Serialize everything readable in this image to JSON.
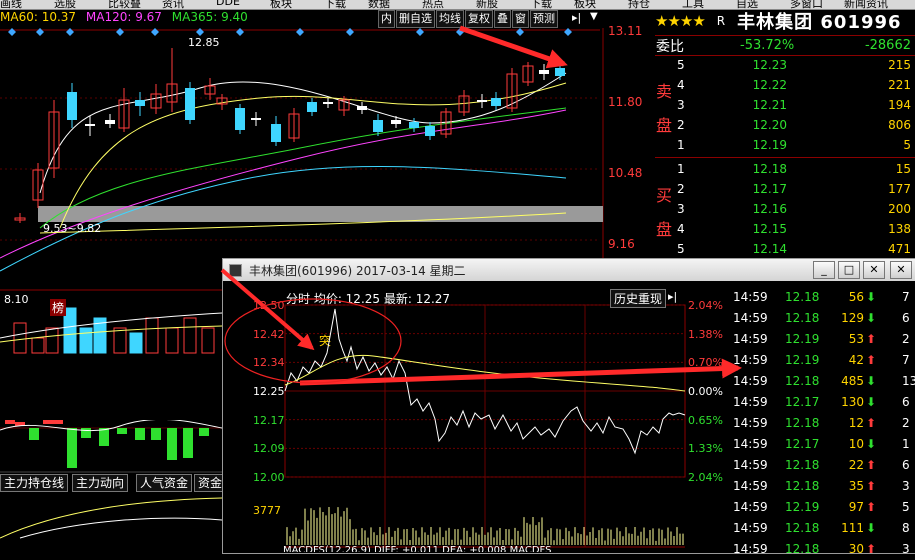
{
  "menu": {
    "items": [
      "画线",
      "选股",
      "比较叠",
      "资讯",
      "DDE",
      "板块",
      "下载",
      "数据",
      "热点",
      "新股",
      "下载",
      "板块",
      "持仓",
      "工具",
      "自选",
      "多窗口",
      "新闻资讯"
    ]
  },
  "ma_bar": {
    "ma60": "MA60: 10.37",
    "ma120": "MA120: 9.67",
    "ma365": "MA365: 9.40"
  },
  "toolbar": {
    "buttons": [
      "内",
      "删自选",
      "均线",
      "复权",
      "叠",
      "窗",
      "预测"
    ]
  },
  "kline": {
    "price_labels": [
      "13.11",
      "11.80",
      "10.48",
      "9.16"
    ],
    "high_label": "12.85",
    "low_label": "9.53~9.82",
    "low2_label": "8.10",
    "bang_label": "榜"
  },
  "sub_tabs": [
    "主力持仓线",
    "主力动向",
    "人气资金",
    "资金"
  ],
  "stock": {
    "stars": "★★★★",
    "r": "R",
    "name": "丰林集团 601996"
  },
  "weibi": {
    "label": "委比",
    "pct": "-53.72%",
    "diff": "-28662"
  },
  "sell_label": [
    "卖",
    "盘"
  ],
  "buy_label": [
    "买",
    "盘"
  ],
  "asks": [
    {
      "level": "5",
      "price": "12.23",
      "volume": "215"
    },
    {
      "level": "4",
      "price": "12.22",
      "volume": "221"
    },
    {
      "level": "3",
      "price": "12.21",
      "volume": "194"
    },
    {
      "level": "2",
      "price": "12.20",
      "volume": "806"
    },
    {
      "level": "1",
      "price": "12.19",
      "volume": "5"
    }
  ],
  "bids": [
    {
      "level": "1",
      "price": "12.18",
      "volume": "15"
    },
    {
      "level": "2",
      "price": "12.17",
      "volume": "177"
    },
    {
      "level": "3",
      "price": "12.16",
      "volume": "200"
    },
    {
      "level": "4",
      "price": "12.15",
      "volume": "138"
    },
    {
      "level": "5",
      "price": "12.14",
      "volume": "471"
    }
  ],
  "popup": {
    "title": "丰林集团(601996) 2017-03-14 星期二",
    "header": "分时 均价: 12.25 最新: 12.27",
    "history_button": "历史重现",
    "left_prices": [
      "12.50",
      "12.42",
      "12.34",
      "12.25",
      "12.17",
      "12.09",
      "12.00"
    ],
    "right_pcts": [
      "2.04%",
      "1.38%",
      "0.70%",
      "0.00%",
      "0.65%",
      "1.33%",
      "2.04%"
    ],
    "volume_label": "3777",
    "tu_label": "突",
    "macd_line": "MACDFS(12,26,9) DIFF: +0.011 DEA: +0.008 MACDFS"
  },
  "ticks": [
    {
      "time": "14:59",
      "price": "12.18",
      "vol": "56",
      "dir": "down",
      "n": "7"
    },
    {
      "time": "14:59",
      "price": "12.18",
      "vol": "129",
      "dir": "down",
      "n": "6"
    },
    {
      "time": "14:59",
      "price": "12.19",
      "vol": "53",
      "dir": "up",
      "n": "2"
    },
    {
      "time": "14:59",
      "price": "12.19",
      "vol": "42",
      "dir": "up",
      "n": "7"
    },
    {
      "time": "14:59",
      "price": "12.18",
      "vol": "485",
      "dir": "down",
      "n": "13"
    },
    {
      "time": "14:59",
      "price": "12.17",
      "vol": "130",
      "dir": "down",
      "n": "6"
    },
    {
      "time": "14:59",
      "price": "12.18",
      "vol": "12",
      "dir": "up",
      "n": "2"
    },
    {
      "time": "14:59",
      "price": "12.17",
      "vol": "10",
      "dir": "down",
      "n": "1"
    },
    {
      "time": "14:59",
      "price": "12.18",
      "vol": "22",
      "dir": "up",
      "n": "6"
    },
    {
      "time": "14:59",
      "price": "12.18",
      "vol": "35",
      "dir": "up",
      "n": "3"
    },
    {
      "time": "14:59",
      "price": "12.19",
      "vol": "97",
      "dir": "up",
      "n": "5"
    },
    {
      "time": "14:59",
      "price": "12.18",
      "vol": "111",
      "dir": "down",
      "n": "8"
    },
    {
      "time": "14:59",
      "price": "12.18",
      "vol": "30",
      "dir": "up",
      "n": "3"
    }
  ]
}
